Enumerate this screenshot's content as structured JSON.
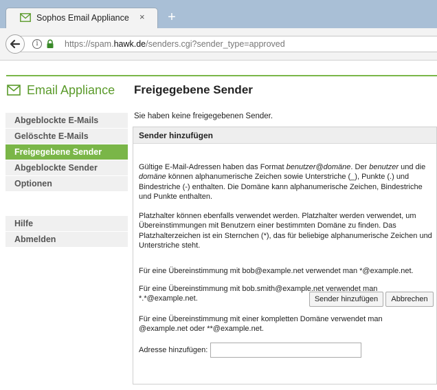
{
  "browser": {
    "tab_title": "Sophos Email Appliance",
    "tab_close": "×",
    "new_tab": "+",
    "url_prefix": "https://spam.",
    "url_host": "hawk.de",
    "url_path": "/senders.cgi?sender_type=approved",
    "info_glyph": "i"
  },
  "brand": {
    "text": "Email Appliance",
    "color": "#5a9a2a",
    "accent": "#7ab648"
  },
  "page": {
    "title": "Freigegebene Sender"
  },
  "sidebar": {
    "items": [
      {
        "label": "Abgeblockte E-Mails",
        "active": false
      },
      {
        "label": "Gelöschte E-Mails",
        "active": false
      },
      {
        "label": "Freigegebene Sender",
        "active": true
      },
      {
        "label": "Abgeblockte Sender",
        "active": false
      },
      {
        "label": "Optionen",
        "active": false
      }
    ],
    "secondary": [
      {
        "label": "Hilfe"
      },
      {
        "label": "Abmelden"
      }
    ]
  },
  "main": {
    "empty_message": "Sie haben keine freigegebenen Sender.",
    "panel_title": "Sender hinzufügen",
    "p1": {
      "a": "Gültige E-Mail-Adressen haben das Format ",
      "em1": "benutzer@domäne",
      "b": ". Der ",
      "em2": "benutzer",
      "c": " und die ",
      "em3": "domäne",
      "d": " können alphanumerische Zeichen sowie Unterstriche (_), Punkte (.) und Bindestriche (-) enthalten. Die Domäne kann alphanumerische Zeichen, Bindestriche und Punkte enthalten."
    },
    "p2": "Platzhalter können ebenfalls verwendet werden. Platzhalter werden verwendet, um Übereinstimmungen mit Benutzern einer bestimmten Domäne zu finden. Das Platzhalterzeichen ist ein Sternchen (*), das für beliebige alphanumerische Zeichen und Unterstriche steht.",
    "p3": "Für eine Übereinstimmung mit bob@example.net verwendet man *@example.net.",
    "p4": "Für eine Übereinstimmung mit bob.smith@example.net verwendet man *.*@example.net.",
    "p5": "Für eine Übereinstimmung mit einer kompletten Domäne verwendet man @example.net oder **@example.net.",
    "add_label": "Adresse hinzufügen:",
    "add_value": "",
    "add_button": "Sender hinzufügen",
    "cancel_button": "Abbrechen"
  }
}
